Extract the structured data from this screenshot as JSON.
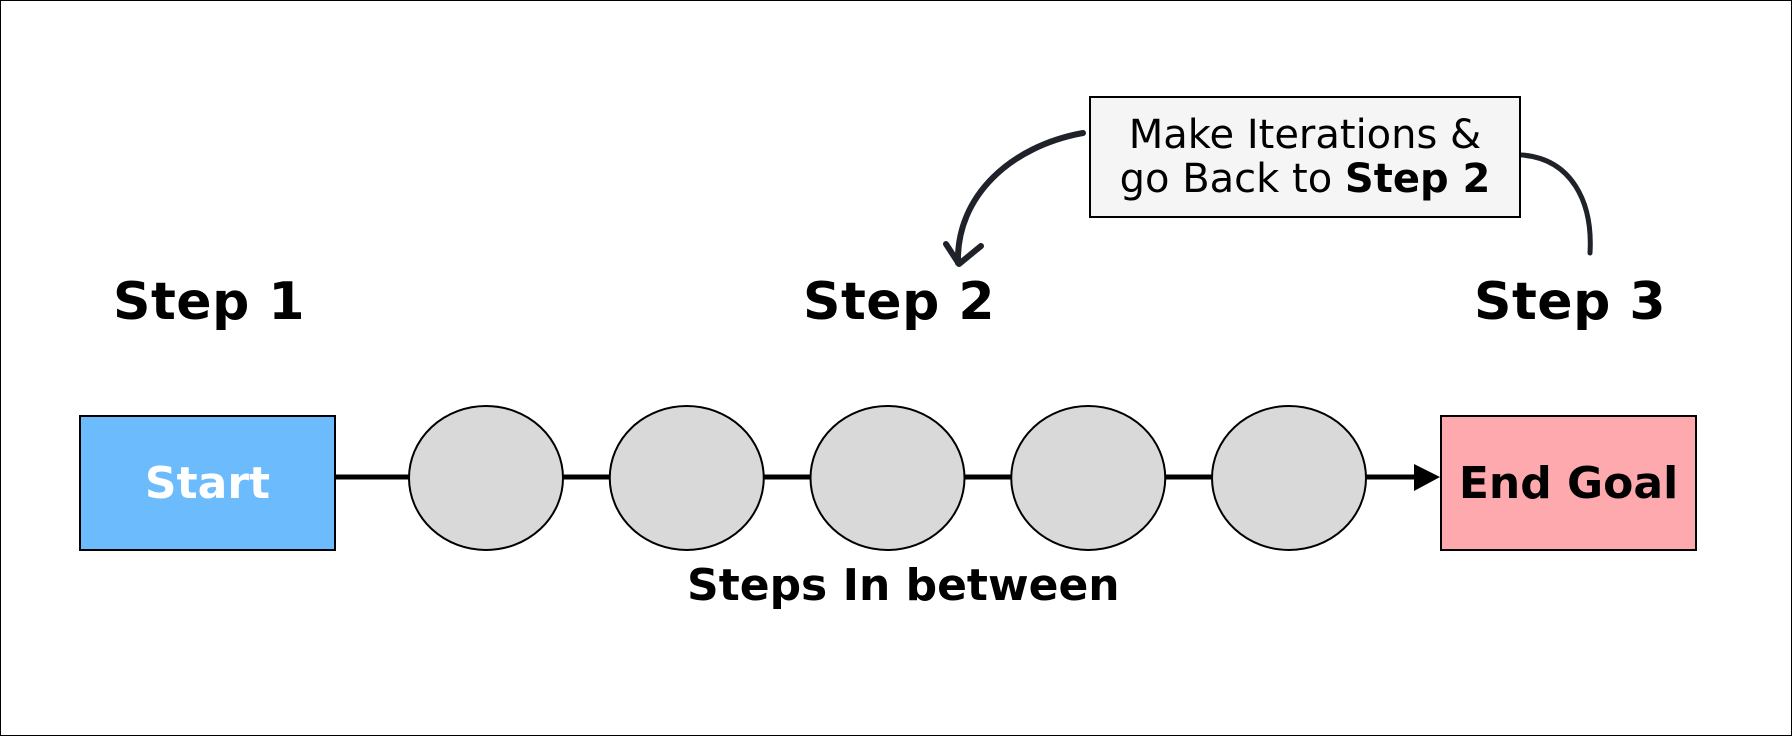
{
  "diagram": {
    "steps": [
      {
        "label": "Step 1"
      },
      {
        "label": "Step 2"
      },
      {
        "label": "Step 3"
      }
    ],
    "start": {
      "label": "Start",
      "color": "#6cbbfd"
    },
    "end": {
      "label": "End Goal",
      "color": "#fea9ae"
    },
    "intermediate_nodes": {
      "count": 5,
      "fill": "#d9d9d9"
    },
    "between_label": "Steps In between",
    "note": {
      "line1": "Make Iterations &",
      "line2_prefix": "go Back to ",
      "line2_bold": "Step 2",
      "background": "#f5f5f5"
    },
    "arrow_color": "#1f2228"
  }
}
